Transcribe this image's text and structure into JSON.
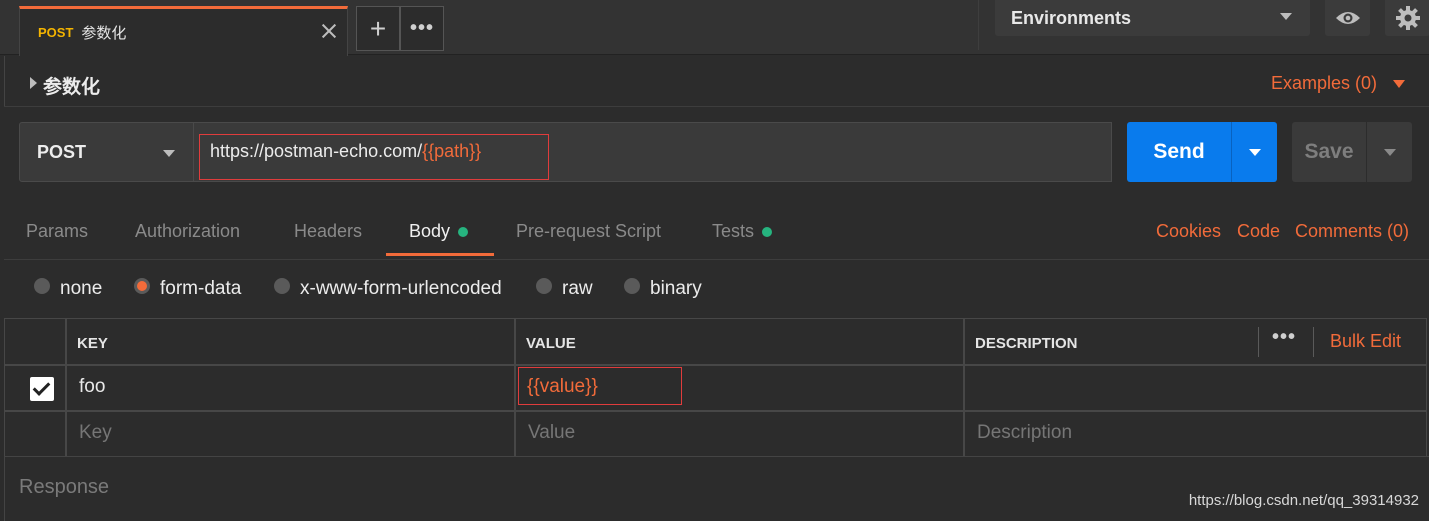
{
  "tab": {
    "method": "POST",
    "name": "参数化"
  },
  "topbar": {
    "environment": "Environments"
  },
  "request": {
    "name": "参数化",
    "examples": "Examples (0)",
    "method": "POST",
    "url_base": "https://postman-echo.com/",
    "url_var": "{{path}}",
    "send_label": "Send",
    "save_label": "Save"
  },
  "tabs": {
    "items": [
      "Params",
      "Authorization",
      "Headers",
      "Body",
      "Pre-request Script",
      "Tests"
    ],
    "active": "Body",
    "links": [
      "Cookies",
      "Code",
      "Comments (0)"
    ]
  },
  "body_types": {
    "options": [
      "none",
      "form-data",
      "x-www-form-urlencoded",
      "raw",
      "binary"
    ],
    "selected": "form-data"
  },
  "table": {
    "headers": [
      "KEY",
      "VALUE",
      "DESCRIPTION"
    ],
    "bulk_edit": "Bulk Edit",
    "rows": [
      {
        "checked": true,
        "key": "foo",
        "value": "{{value}}",
        "description": ""
      }
    ],
    "placeholders": {
      "key": "Key",
      "value": "Value",
      "description": "Description"
    }
  },
  "response": {
    "label": "Response"
  },
  "watermark": "https://blog.csdn.net/qq_39314932",
  "colors": {
    "accent": "#f26b3a",
    "send": "#097bed",
    "dot_green": "#26b47f",
    "highlight_box": "#e03c3c"
  }
}
